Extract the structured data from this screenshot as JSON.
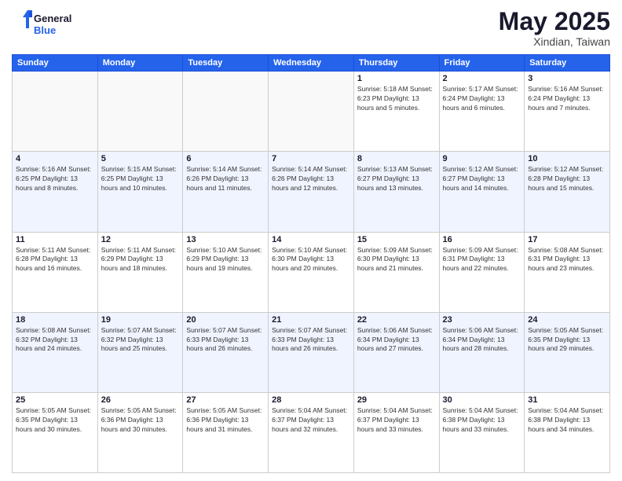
{
  "logo": {
    "text_general": "General",
    "text_blue": "Blue"
  },
  "title": {
    "month": "May 2025",
    "location": "Xindian, Taiwan"
  },
  "weekdays": [
    "Sunday",
    "Monday",
    "Tuesday",
    "Wednesday",
    "Thursday",
    "Friday",
    "Saturday"
  ],
  "weeks": [
    [
      {
        "day": "",
        "info": ""
      },
      {
        "day": "",
        "info": ""
      },
      {
        "day": "",
        "info": ""
      },
      {
        "day": "",
        "info": ""
      },
      {
        "day": "1",
        "info": "Sunrise: 5:18 AM\nSunset: 6:23 PM\nDaylight: 13 hours\nand 5 minutes."
      },
      {
        "day": "2",
        "info": "Sunrise: 5:17 AM\nSunset: 6:24 PM\nDaylight: 13 hours\nand 6 minutes."
      },
      {
        "day": "3",
        "info": "Sunrise: 5:16 AM\nSunset: 6:24 PM\nDaylight: 13 hours\nand 7 minutes."
      }
    ],
    [
      {
        "day": "4",
        "info": "Sunrise: 5:16 AM\nSunset: 6:25 PM\nDaylight: 13 hours\nand 8 minutes."
      },
      {
        "day": "5",
        "info": "Sunrise: 5:15 AM\nSunset: 6:25 PM\nDaylight: 13 hours\nand 10 minutes."
      },
      {
        "day": "6",
        "info": "Sunrise: 5:14 AM\nSunset: 6:26 PM\nDaylight: 13 hours\nand 11 minutes."
      },
      {
        "day": "7",
        "info": "Sunrise: 5:14 AM\nSunset: 6:26 PM\nDaylight: 13 hours\nand 12 minutes."
      },
      {
        "day": "8",
        "info": "Sunrise: 5:13 AM\nSunset: 6:27 PM\nDaylight: 13 hours\nand 13 minutes."
      },
      {
        "day": "9",
        "info": "Sunrise: 5:12 AM\nSunset: 6:27 PM\nDaylight: 13 hours\nand 14 minutes."
      },
      {
        "day": "10",
        "info": "Sunrise: 5:12 AM\nSunset: 6:28 PM\nDaylight: 13 hours\nand 15 minutes."
      }
    ],
    [
      {
        "day": "11",
        "info": "Sunrise: 5:11 AM\nSunset: 6:28 PM\nDaylight: 13 hours\nand 16 minutes."
      },
      {
        "day": "12",
        "info": "Sunrise: 5:11 AM\nSunset: 6:29 PM\nDaylight: 13 hours\nand 18 minutes."
      },
      {
        "day": "13",
        "info": "Sunrise: 5:10 AM\nSunset: 6:29 PM\nDaylight: 13 hours\nand 19 minutes."
      },
      {
        "day": "14",
        "info": "Sunrise: 5:10 AM\nSunset: 6:30 PM\nDaylight: 13 hours\nand 20 minutes."
      },
      {
        "day": "15",
        "info": "Sunrise: 5:09 AM\nSunset: 6:30 PM\nDaylight: 13 hours\nand 21 minutes."
      },
      {
        "day": "16",
        "info": "Sunrise: 5:09 AM\nSunset: 6:31 PM\nDaylight: 13 hours\nand 22 minutes."
      },
      {
        "day": "17",
        "info": "Sunrise: 5:08 AM\nSunset: 6:31 PM\nDaylight: 13 hours\nand 23 minutes."
      }
    ],
    [
      {
        "day": "18",
        "info": "Sunrise: 5:08 AM\nSunset: 6:32 PM\nDaylight: 13 hours\nand 24 minutes."
      },
      {
        "day": "19",
        "info": "Sunrise: 5:07 AM\nSunset: 6:32 PM\nDaylight: 13 hours\nand 25 minutes."
      },
      {
        "day": "20",
        "info": "Sunrise: 5:07 AM\nSunset: 6:33 PM\nDaylight: 13 hours\nand 26 minutes."
      },
      {
        "day": "21",
        "info": "Sunrise: 5:07 AM\nSunset: 6:33 PM\nDaylight: 13 hours\nand 26 minutes."
      },
      {
        "day": "22",
        "info": "Sunrise: 5:06 AM\nSunset: 6:34 PM\nDaylight: 13 hours\nand 27 minutes."
      },
      {
        "day": "23",
        "info": "Sunrise: 5:06 AM\nSunset: 6:34 PM\nDaylight: 13 hours\nand 28 minutes."
      },
      {
        "day": "24",
        "info": "Sunrise: 5:05 AM\nSunset: 6:35 PM\nDaylight: 13 hours\nand 29 minutes."
      }
    ],
    [
      {
        "day": "25",
        "info": "Sunrise: 5:05 AM\nSunset: 6:35 PM\nDaylight: 13 hours\nand 30 minutes."
      },
      {
        "day": "26",
        "info": "Sunrise: 5:05 AM\nSunset: 6:36 PM\nDaylight: 13 hours\nand 30 minutes."
      },
      {
        "day": "27",
        "info": "Sunrise: 5:05 AM\nSunset: 6:36 PM\nDaylight: 13 hours\nand 31 minutes."
      },
      {
        "day": "28",
        "info": "Sunrise: 5:04 AM\nSunset: 6:37 PM\nDaylight: 13 hours\nand 32 minutes."
      },
      {
        "day": "29",
        "info": "Sunrise: 5:04 AM\nSunset: 6:37 PM\nDaylight: 13 hours\nand 33 minutes."
      },
      {
        "day": "30",
        "info": "Sunrise: 5:04 AM\nSunset: 6:38 PM\nDaylight: 13 hours\nand 33 minutes."
      },
      {
        "day": "31",
        "info": "Sunrise: 5:04 AM\nSunset: 6:38 PM\nDaylight: 13 hours\nand 34 minutes."
      }
    ]
  ]
}
